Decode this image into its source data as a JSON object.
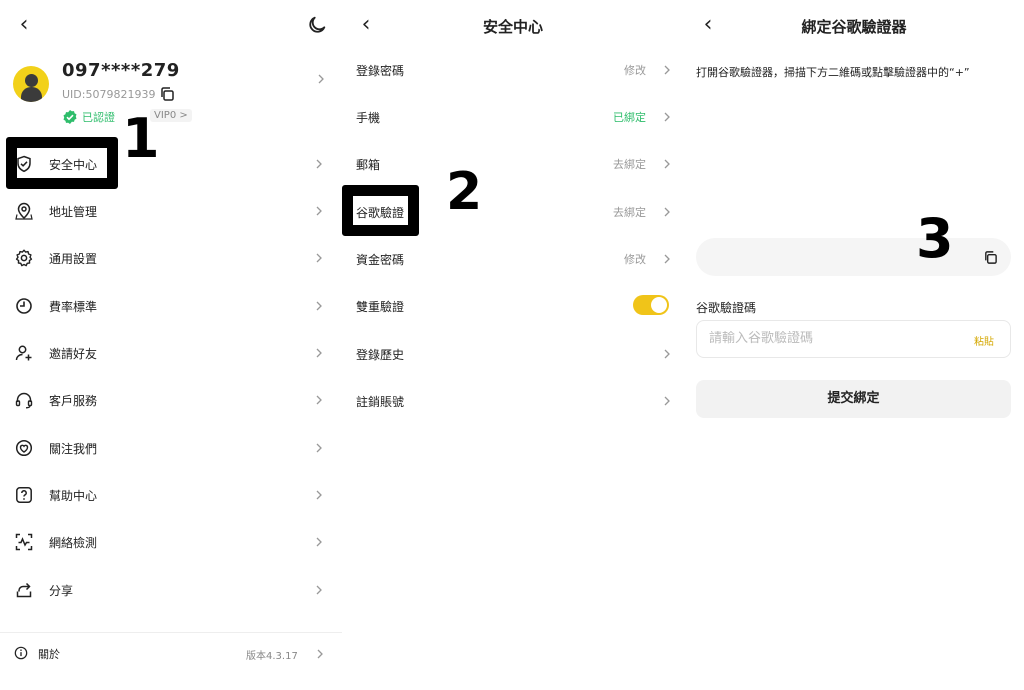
{
  "panel1": {
    "profile": {
      "phone": "097****279",
      "uid": "UID:5079821939",
      "verified": "已認證",
      "vip": "VIP0 >"
    },
    "menu": [
      {
        "label": "安全中心",
        "icon": "shield-check-icon"
      },
      {
        "label": "地址管理",
        "icon": "location-icon"
      },
      {
        "label": "通用設置",
        "icon": "gear-icon"
      },
      {
        "label": "費率標準",
        "icon": "clock-icon"
      },
      {
        "label": "邀請好友",
        "icon": "add-user-icon"
      },
      {
        "label": "客戶服務",
        "icon": "headset-icon"
      },
      {
        "label": "關注我們",
        "icon": "heart-icon"
      },
      {
        "label": "幫助中心",
        "icon": "question-icon"
      },
      {
        "label": "網絡檢測",
        "icon": "network-scan-icon"
      },
      {
        "label": "分享",
        "icon": "share-icon"
      }
    ],
    "about": {
      "label": "關於",
      "version": "版本4.3.17"
    },
    "step_number": "1"
  },
  "panel2": {
    "title": "安全中心",
    "rows": [
      {
        "label": "登錄密碼",
        "value": "修改"
      },
      {
        "label": "手機",
        "value": "已綁定"
      },
      {
        "label": "郵箱",
        "value": "去綁定"
      },
      {
        "label": "谷歌驗證",
        "value": "去綁定"
      },
      {
        "label": "資金密碼",
        "value": "修改"
      },
      {
        "label": "雙重驗證",
        "value": ""
      },
      {
        "label": "登錄歷史",
        "value": ""
      },
      {
        "label": "註銷賬號",
        "value": ""
      }
    ],
    "two_factor_enabled": true,
    "step_number": "2"
  },
  "panel3": {
    "title": "綁定谷歌驗證器",
    "instruction": "打開谷歌驗證器，掃描下方二維碼或點擊驗證器中的“+”",
    "code_label": "谷歌驗證碼",
    "code_placeholder": "請輸入谷歌驗證碼",
    "paste_label": "粘貼",
    "submit_label": "提交綁定",
    "step_number": "3"
  },
  "colors": {
    "accent_yellow": "#f0c419",
    "verified_green": "#2ebd6b",
    "paste_gold": "#d4a700"
  }
}
